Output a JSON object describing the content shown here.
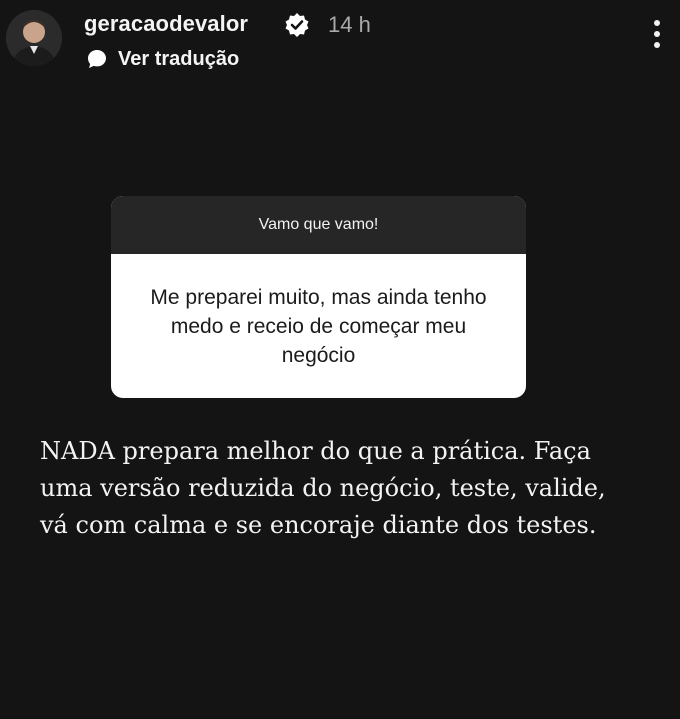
{
  "header": {
    "username": "geracaodevalor",
    "verified_icon": "verified-badge-icon",
    "time_ago": "14 h",
    "menu_icon": "more-vertical-icon",
    "translate_icon": "speech-bubble-icon",
    "translate_label": "Ver tradução"
  },
  "question_box": {
    "title": "Vamo que vamo!",
    "question": "Me preparei muito, mas ainda tenho medo e receio de começar meu negócio"
  },
  "answer_text": "NADA prepara melhor do que a prática. Faça uma versão reduzida do negócio, teste, valide, vá com calma e se encoraje diante dos testes.",
  "colors": {
    "background": "#141414",
    "question_header": "#262626",
    "question_body": "#ffffff",
    "muted_text": "#a9a9a9"
  }
}
